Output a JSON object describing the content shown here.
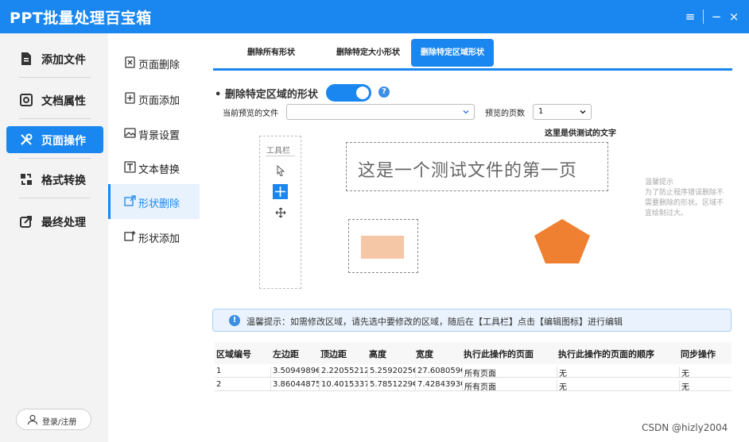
{
  "app": {
    "title": "PPT批量处理百宝箱",
    "window_controls": [
      "≡",
      "−",
      "×"
    ]
  },
  "sidebar": {
    "items": [
      {
        "label": "添加文件",
        "icon": "file-icon",
        "active": false
      },
      {
        "label": "文档属性",
        "icon": "properties-icon",
        "active": false
      },
      {
        "label": "页面操作",
        "icon": "tools-icon",
        "active": true
      },
      {
        "label": "格式转换",
        "icon": "convert-icon",
        "active": false
      },
      {
        "label": "最终处理",
        "icon": "export-icon",
        "active": false
      }
    ],
    "login_label": "登录/注册"
  },
  "subnav": {
    "items": [
      {
        "label": "页面删除",
        "icon": "page-delete-icon"
      },
      {
        "label": "页面添加",
        "icon": "page-add-icon"
      },
      {
        "label": "背景设置",
        "icon": "background-icon"
      },
      {
        "label": "文本替换",
        "icon": "text-replace-icon"
      },
      {
        "label": "形状删除",
        "icon": "shape-delete-icon",
        "active": true
      },
      {
        "label": "形状添加",
        "icon": "shape-add-icon"
      }
    ]
  },
  "tabs": [
    {
      "label": "删除所有形状",
      "active": false
    },
    {
      "label": "删除特定大小形状",
      "active": false
    },
    {
      "label": "删除特定区域形状",
      "active": true
    }
  ],
  "section": {
    "title": "删除特定区域的形状",
    "toggle_on": true,
    "help_glyph": "?"
  },
  "preview": {
    "file_label": "当前预览的文件",
    "file_value": "",
    "page_label": "预览的页数",
    "page_value": "1",
    "caption": "这里是供测试的文字",
    "toolbox_title": "工具栏",
    "slide_text": "这是一个测试文件的第一页",
    "side_tip": "温馨提示\n为了防止程序错误删除不需要删除的形状。区域不宜绘制过大。"
  },
  "notice": {
    "glyph": "!",
    "text": "温馨提示：如需修改区域，请先选中要修改的区域，随后在【工具栏】点击【编辑图标】进行编辑"
  },
  "table": {
    "headers": [
      "区域编号",
      "左边距",
      "顶边距",
      "高度",
      "宽度",
      "执行此操作的页面",
      "执行此操作的页面的顺序",
      "同步操作"
    ],
    "rows": [
      [
        "1",
        "3.5094989€",
        "2.22055212",
        "5.2592025€",
        "27.608059€",
        "所有页面",
        "无",
        "无"
      ],
      [
        "2",
        "3.86044875",
        "10.4015337",
        "5.7851229€",
        "7.4284393€",
        "所有页面",
        "无",
        "无"
      ]
    ]
  },
  "watermark": "CSDN @hizly2004",
  "colors": {
    "accent": "#1a87f0",
    "shape_orange": "#ef7f31",
    "rect_fill": "#f6c7a7"
  }
}
